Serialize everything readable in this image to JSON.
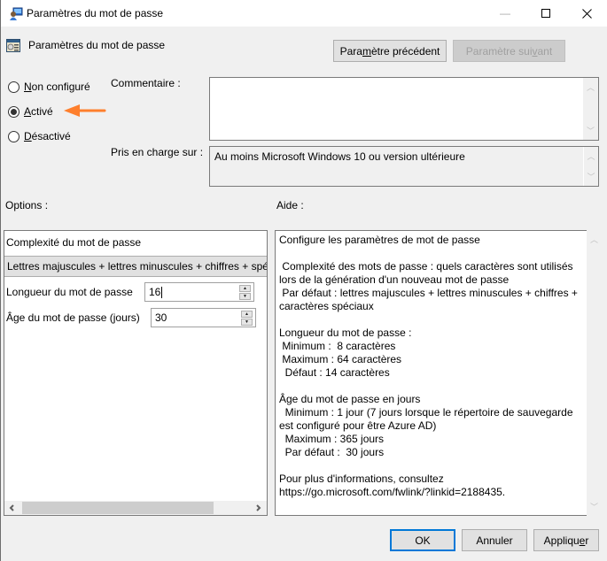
{
  "window": {
    "title": "Paramètres du mot de passe",
    "controls": {
      "minimize": "—",
      "maximize": "☐",
      "close": "✕"
    }
  },
  "header": {
    "title": "Paramètres du mot de passe",
    "prev_button": {
      "pre": "Para",
      "u": "m",
      "post": "ètre précédent"
    },
    "next_button": {
      "pre": "Paramètre sui",
      "u": "v",
      "post": "ant",
      "enabled": false
    }
  },
  "state": {
    "options": [
      {
        "u": "N",
        "rest": "on configuré",
        "selected": false
      },
      {
        "u": "A",
        "rest": "ctivé",
        "selected": true
      },
      {
        "u": "D",
        "rest": "ésactivé",
        "selected": false
      }
    ],
    "annotation_arrow_color": "#fe7f2d"
  },
  "comment": {
    "label": "Commentaire :",
    "value": ""
  },
  "supported": {
    "label": "Pris en charge sur :",
    "value": "Au moins Microsoft Windows 10 ou version ultérieure"
  },
  "options_section": {
    "label": "Options :",
    "complexity_label": "Complexité du mot de passe",
    "complexity_value": "Lettres majuscules + lettres minuscules + chiffres + spéciaux",
    "length_label": "Longueur du mot de passe",
    "length_value": "16",
    "age_label": "Âge du mot de passe (jours)",
    "age_value": "30"
  },
  "help_section": {
    "label": "Aide :",
    "text": "Configure les paramètres de mot de passe\n\n Complexité des mots de passe : quels caractères sont utilisés lors de la génération d'un nouveau mot de passe\n Par défaut : lettres majuscules + lettres minuscules + chiffres + caractères spéciaux\n\nLongueur du mot de passe :\n Minimum :  8 caractères\n Maximum : 64 caractères\n  Défaut : 14 caractères\n\nÂge du mot de passe en jours\n  Minimum : 1 jour (7 jours lorsque le répertoire de sauvegarde est configuré pour être Azure AD)\n  Maximum : 365 jours\n  Par défaut :  30 jours\n\nPour plus d'informations, consultez https://go.microsoft.com/fwlink/?linkid=2188435."
  },
  "footer": {
    "ok": "OK",
    "cancel": "Annuler",
    "apply": {
      "pre": "Appliqu",
      "u": "e",
      "post": "r"
    }
  }
}
